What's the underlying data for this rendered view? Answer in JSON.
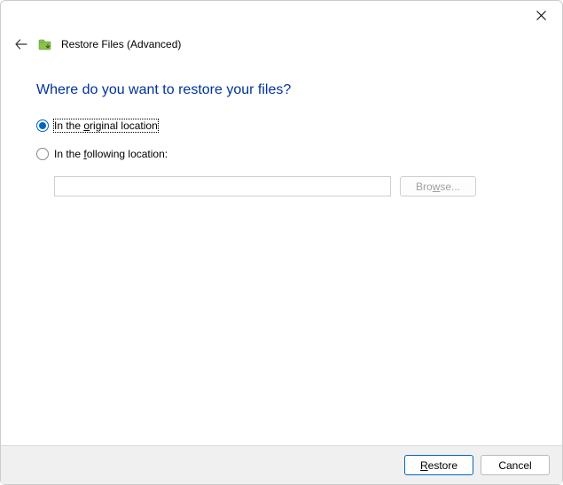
{
  "window": {
    "title": "Restore Files (Advanced)"
  },
  "heading": "Where do you want to restore your files?",
  "options": {
    "original": {
      "label": "In the original location",
      "checked": true
    },
    "following": {
      "label": "In the following location:",
      "checked": false
    }
  },
  "browse": {
    "path_value": "",
    "button_label": "Browse..."
  },
  "footer": {
    "primary_label": "Restore",
    "cancel_label": "Cancel"
  }
}
